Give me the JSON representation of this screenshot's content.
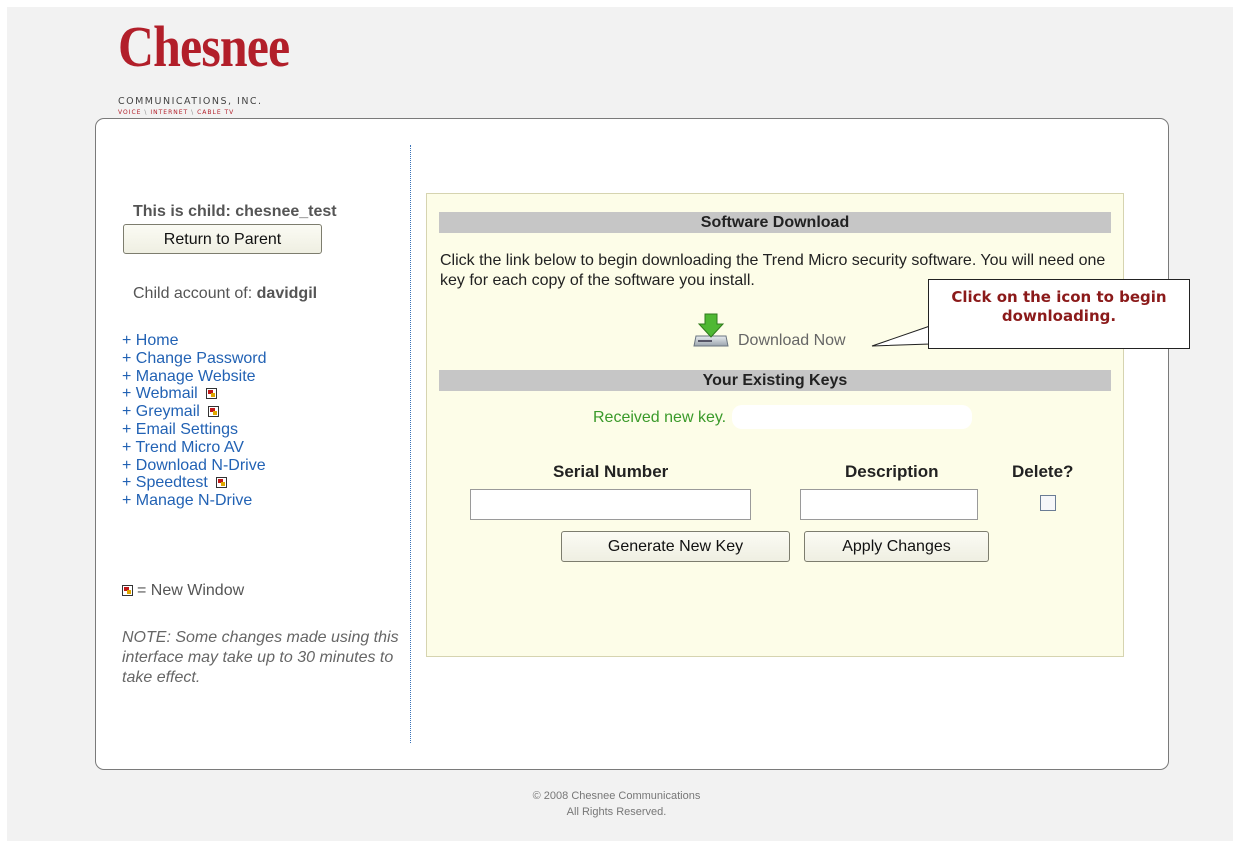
{
  "logo": {
    "wordmark": "Chesnee",
    "company": "COMMUNICATIONS, INC.",
    "tagline": [
      "VOICE",
      "INTERNET",
      "CABLE TV"
    ]
  },
  "sidebar": {
    "child_title": "This is child: chesnee_test",
    "return_button": "Return to Parent",
    "child_of_label": "Child account of:",
    "child_of_user": "davidgil",
    "nav_items": [
      {
        "label": "+ Home",
        "new_window": false
      },
      {
        "label": "+ Change Password",
        "new_window": false
      },
      {
        "label": "+ Manage Website",
        "new_window": false
      },
      {
        "label": "+ Webmail",
        "new_window": true
      },
      {
        "label": "+ Greymail",
        "new_window": true
      },
      {
        "label": "+ Email Settings",
        "new_window": false
      },
      {
        "label": "+ Trend Micro AV",
        "new_window": false
      },
      {
        "label": "+ Download N-Drive",
        "new_window": false
      },
      {
        "label": "+ Speedtest",
        "new_window": true
      },
      {
        "label": "+ Manage N-Drive",
        "new_window": false
      }
    ],
    "legend": "= New Window",
    "note": "NOTE: Some changes made using this interface may take up to 30 minutes to take effect."
  },
  "content": {
    "download_header": "Software Download",
    "download_intro": "Click the link below to begin downloading the Trend Micro security software. You will need one key for each copy of the software you install.",
    "download_link": "Download Now",
    "callout": "Click on the icon to begin downloading.",
    "keys_header": "Your Existing Keys",
    "received_msg": "Received new key.",
    "col_serial": "Serial Number",
    "col_description": "Description",
    "col_delete": "Delete?",
    "serial_value": "",
    "description_value": "",
    "generate_button": "Generate New Key",
    "apply_button": "Apply Changes"
  },
  "footer": {
    "copyright": "© 2008 Chesnee Communications",
    "rights": "All Rights Reserved."
  },
  "colors": {
    "brand_red": "#b21f2a",
    "link_blue": "#2262b4",
    "panel_bg": "#fdfde8",
    "section_bar": "#c6c6c6",
    "success_green": "#3a9a2a",
    "callout_text": "#8b1a1a"
  }
}
